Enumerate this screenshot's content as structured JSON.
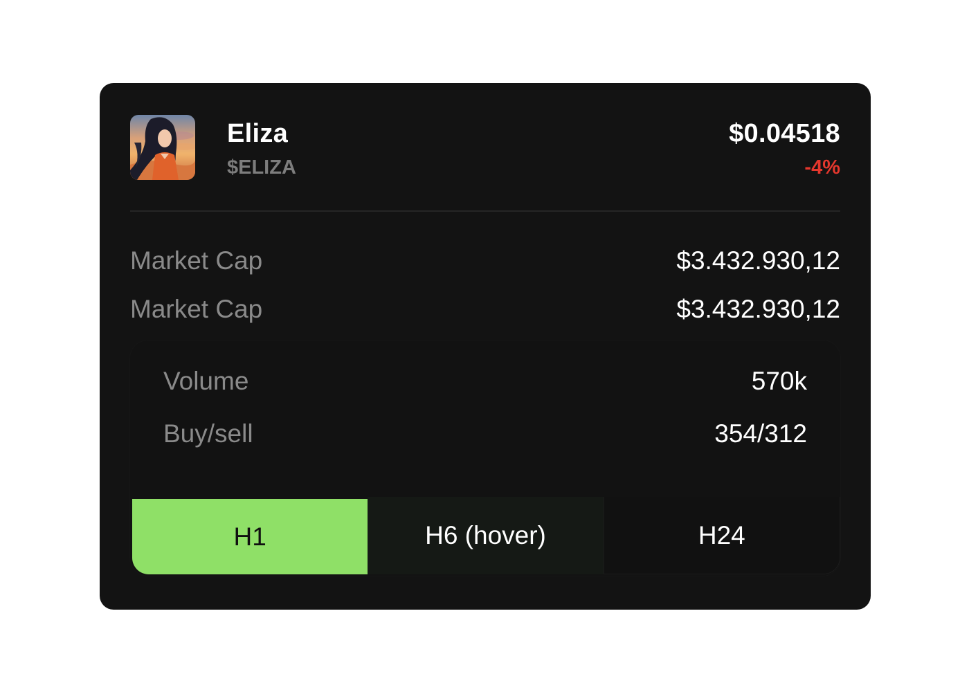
{
  "token": {
    "name": "Eliza",
    "ticker": "$ELIZA",
    "price": "$0.04518",
    "change": "-4%",
    "change_color": "#e5372d",
    "avatar_icon": "anime-girl-sunset-avatar"
  },
  "stats": [
    {
      "label": "Market Cap",
      "value": "$3.432.930,12"
    },
    {
      "label": "Market Cap",
      "value": "$3.432.930,12"
    }
  ],
  "panel": {
    "rows": [
      {
        "label": "Volume",
        "value": "570k"
      },
      {
        "label": "Buy/sell",
        "value": "354/312"
      }
    ],
    "tabs": [
      {
        "label": "H1",
        "state": "active"
      },
      {
        "label": "H6 (hover)",
        "state": "hover"
      },
      {
        "label": "H24",
        "state": "default"
      }
    ],
    "accent_color": "#8fe067"
  }
}
